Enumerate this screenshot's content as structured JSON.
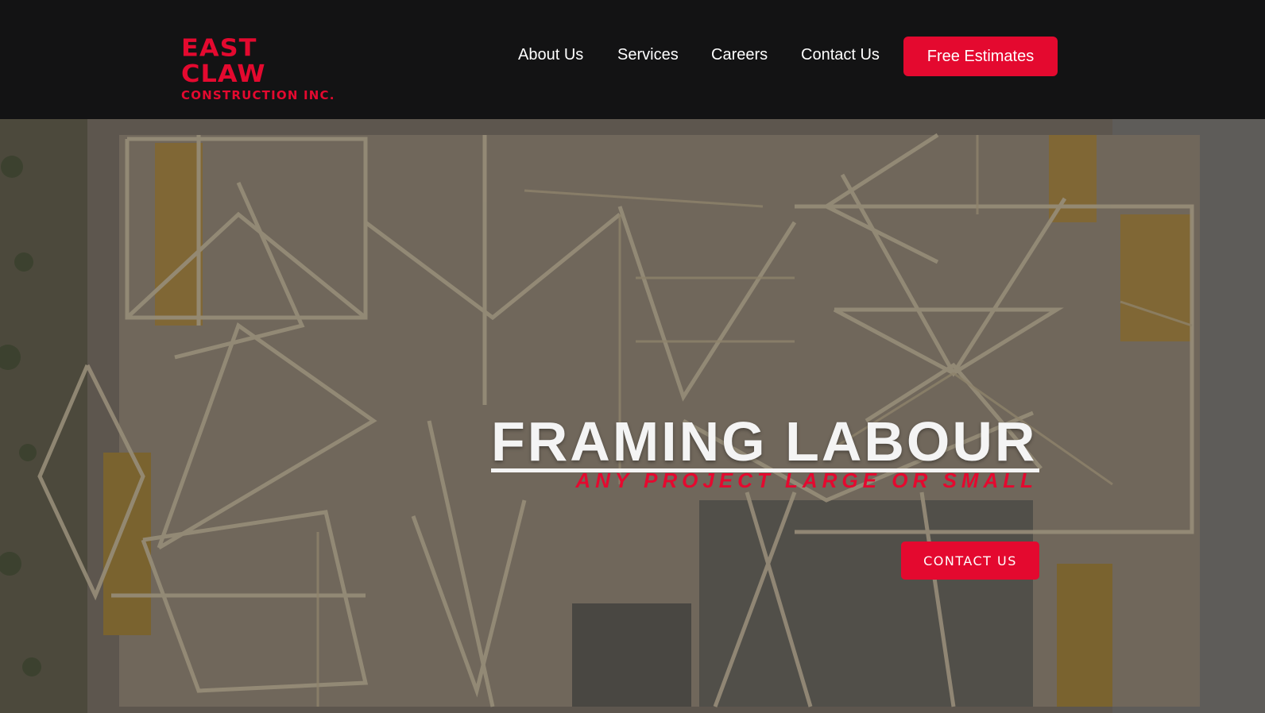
{
  "header": {
    "logo": {
      "line1": "EAST CLAW",
      "line2": "CONSTRUCTION INC."
    },
    "nav": {
      "about": "About Us",
      "services": "Services",
      "careers": "Careers",
      "contact": "Contact Us"
    },
    "cta": "Free Estimates"
  },
  "hero": {
    "title": "FRAMING LABOUR",
    "subtitle": "ANY PROJECT LARGE OR SMALL",
    "button": "CONTACT US"
  },
  "colors": {
    "accent": "#e4092f",
    "header_bg": "#131314",
    "text_light": "#f4f4f4"
  }
}
